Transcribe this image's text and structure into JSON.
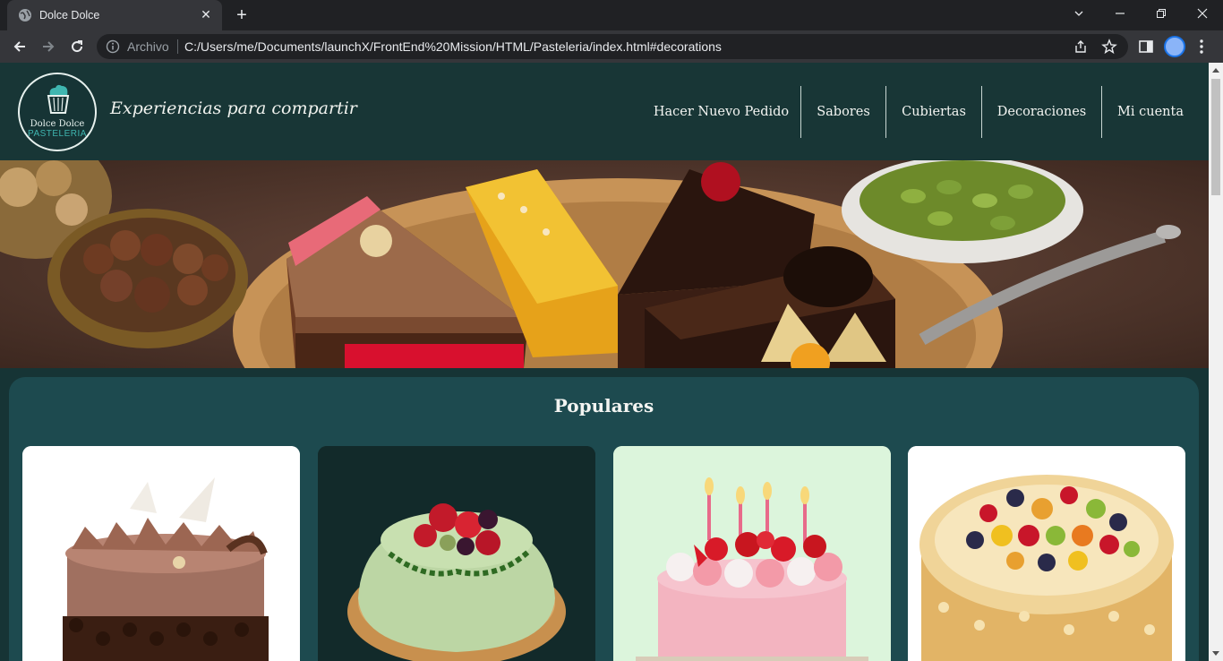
{
  "browser": {
    "tab_title": "Dolce Dolce",
    "address_prefix": "Archivo",
    "url": "C:/Users/me/Documents/launchX/FrontEnd%20Mission/HTML/Pasteleria/index.html#decorations"
  },
  "site": {
    "logo_line1": "Dolce Dolce",
    "logo_line2": "PASTELERIA",
    "tagline": "Experiencias para compartir",
    "nav": [
      "Hacer Nuevo Pedido",
      "Sabores",
      "Cubiertas",
      "Decoraciones",
      "Mi cuenta"
    ]
  },
  "popular": {
    "title": "Populares",
    "cards": [
      {
        "name": "chocolate-cake",
        "bg": "#ffffff"
      },
      {
        "name": "fruit-cream-cake",
        "bg": "#122a2a"
      },
      {
        "name": "strawberry-candle-cake",
        "bg": "#dcf5dc"
      },
      {
        "name": "fruit-almond-cake",
        "bg": "#ffffff"
      }
    ]
  },
  "colors": {
    "header_bg": "#183636",
    "section_bg": "#1d4a4f",
    "accent": "#3fb6b0"
  }
}
